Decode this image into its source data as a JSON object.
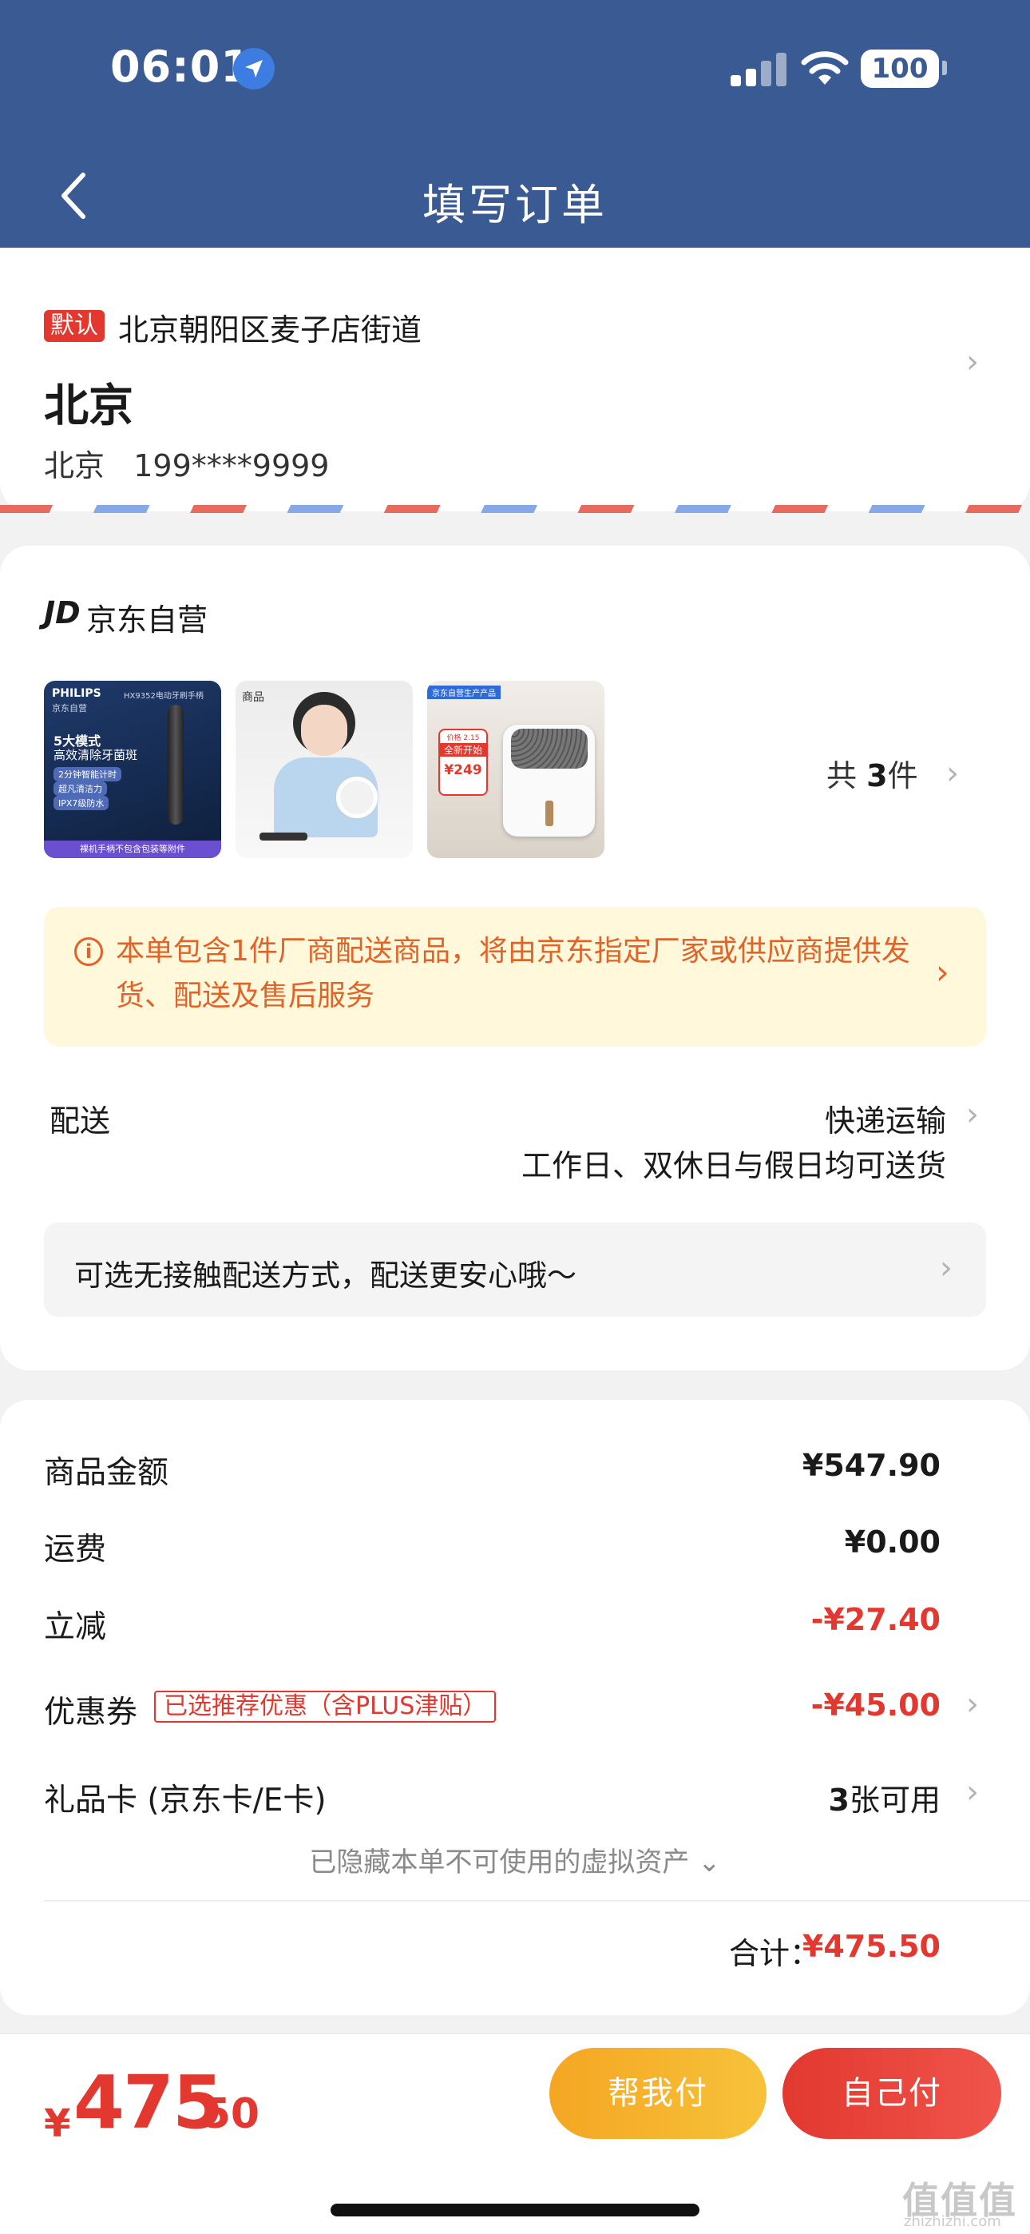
{
  "status_bar": {
    "time": "06:01",
    "battery": "100"
  },
  "nav": {
    "title": "填写订单"
  },
  "address": {
    "default_tag": "默认",
    "line": "北京朝阳区麦子店街道",
    "name": "北京",
    "contact": "北京   199****9999"
  },
  "order": {
    "store_logo": "JD",
    "store_name": "京东自营",
    "item_count_prefix": "共",
    "item_count": "3",
    "item_count_suffix": "件",
    "thumbnails": [
      {
        "brand": "PHILIPS",
        "sub": "京东自营",
        "model": "HX9352电动牙刷手柄",
        "headline": "5大模式",
        "headline2": "高效清除牙菌斑",
        "bullets": [
          "2分钟智能计时",
          "超凡清洁力",
          "IPX7级防水"
        ],
        "footer": "裸机手柄不包含包装等附件"
      },
      {
        "tag": "商品"
      },
      {
        "badge": "全新开始",
        "price": "¥249",
        "note": "价格 2.15",
        "corner": "京东自营生产产品"
      }
    ],
    "notice": "本单包含1件厂商配送商品，将由京东指定厂家或供应商提供发货、配送及售后服务",
    "shipping_label": "配送",
    "shipping_method": "快递运输",
    "shipping_time": "工作日、双休日与假日均可送货",
    "contactless": "可选无接触配送方式，配送更安心哦～"
  },
  "prices": {
    "goods_label": "商品金额",
    "goods_value": "¥547.90",
    "shipping_label": "运费",
    "shipping_value": "¥0.00",
    "discount_label": "立减",
    "discount_value": "-¥27.40",
    "coupon_label": "优惠券",
    "coupon_tag": "已选推荐优惠（含PLUS津贴）",
    "coupon_value": "-¥45.00",
    "giftcard_label": "礼品卡 (京东卡/E卡)",
    "giftcard_count": "3",
    "giftcard_suffix": "张可用",
    "hidden_assets": "已隐藏本单不可使用的虚拟资产 ⌄",
    "total_label": "合计：",
    "total_value": "¥475.50"
  },
  "bottom": {
    "yen": "¥",
    "amount_int": "475",
    "amount_dec": ".50",
    "help_pay": "帮我付",
    "self_pay": "自己付"
  },
  "watermark": {
    "text": "值值值",
    "sub": "zhizhizhi.com"
  },
  "colors": {
    "nav_blue": "#3a5a93",
    "accent_red": "#e2382f",
    "notice_orange": "#e0642a",
    "help_gold": "#f5a623"
  }
}
